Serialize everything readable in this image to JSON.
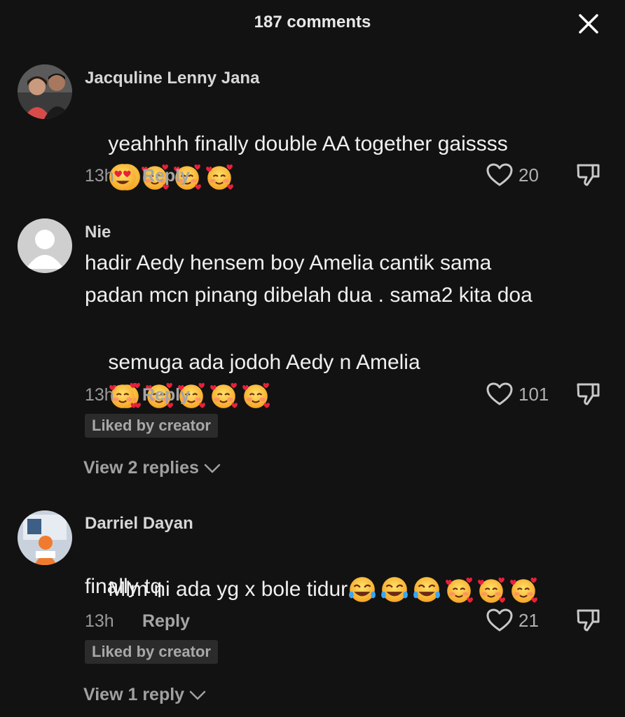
{
  "header": {
    "title": "187 comments"
  },
  "comments": [
    {
      "username": "Jacquline Lenny Jana",
      "text_line1": "yeahhhh finally double AA together gaissss",
      "time": "13h",
      "reply_label": "Reply",
      "likes": "20"
    },
    {
      "username": "Nie",
      "text_line1": "hadir Aedy hensem boy Amelia cantik sama",
      "text_line2": "padan mcn pinang dibelah dua . sama2 kita doa",
      "text_line3": "semuga ada jodoh Aedy n Amelia",
      "time": "13h",
      "reply_label": "Reply",
      "likes": "101",
      "badge": "Liked by creator",
      "view_replies": "View 2 replies"
    },
    {
      "username": "Darriel Dayan",
      "text_line1": "Mlm ni ada yg x bole tidur",
      "text_line2": "finally tq",
      "time": "13h",
      "reply_label": "Reply",
      "likes": "21",
      "badge": "Liked by creator",
      "view_replies": "View 1 reply"
    }
  ]
}
